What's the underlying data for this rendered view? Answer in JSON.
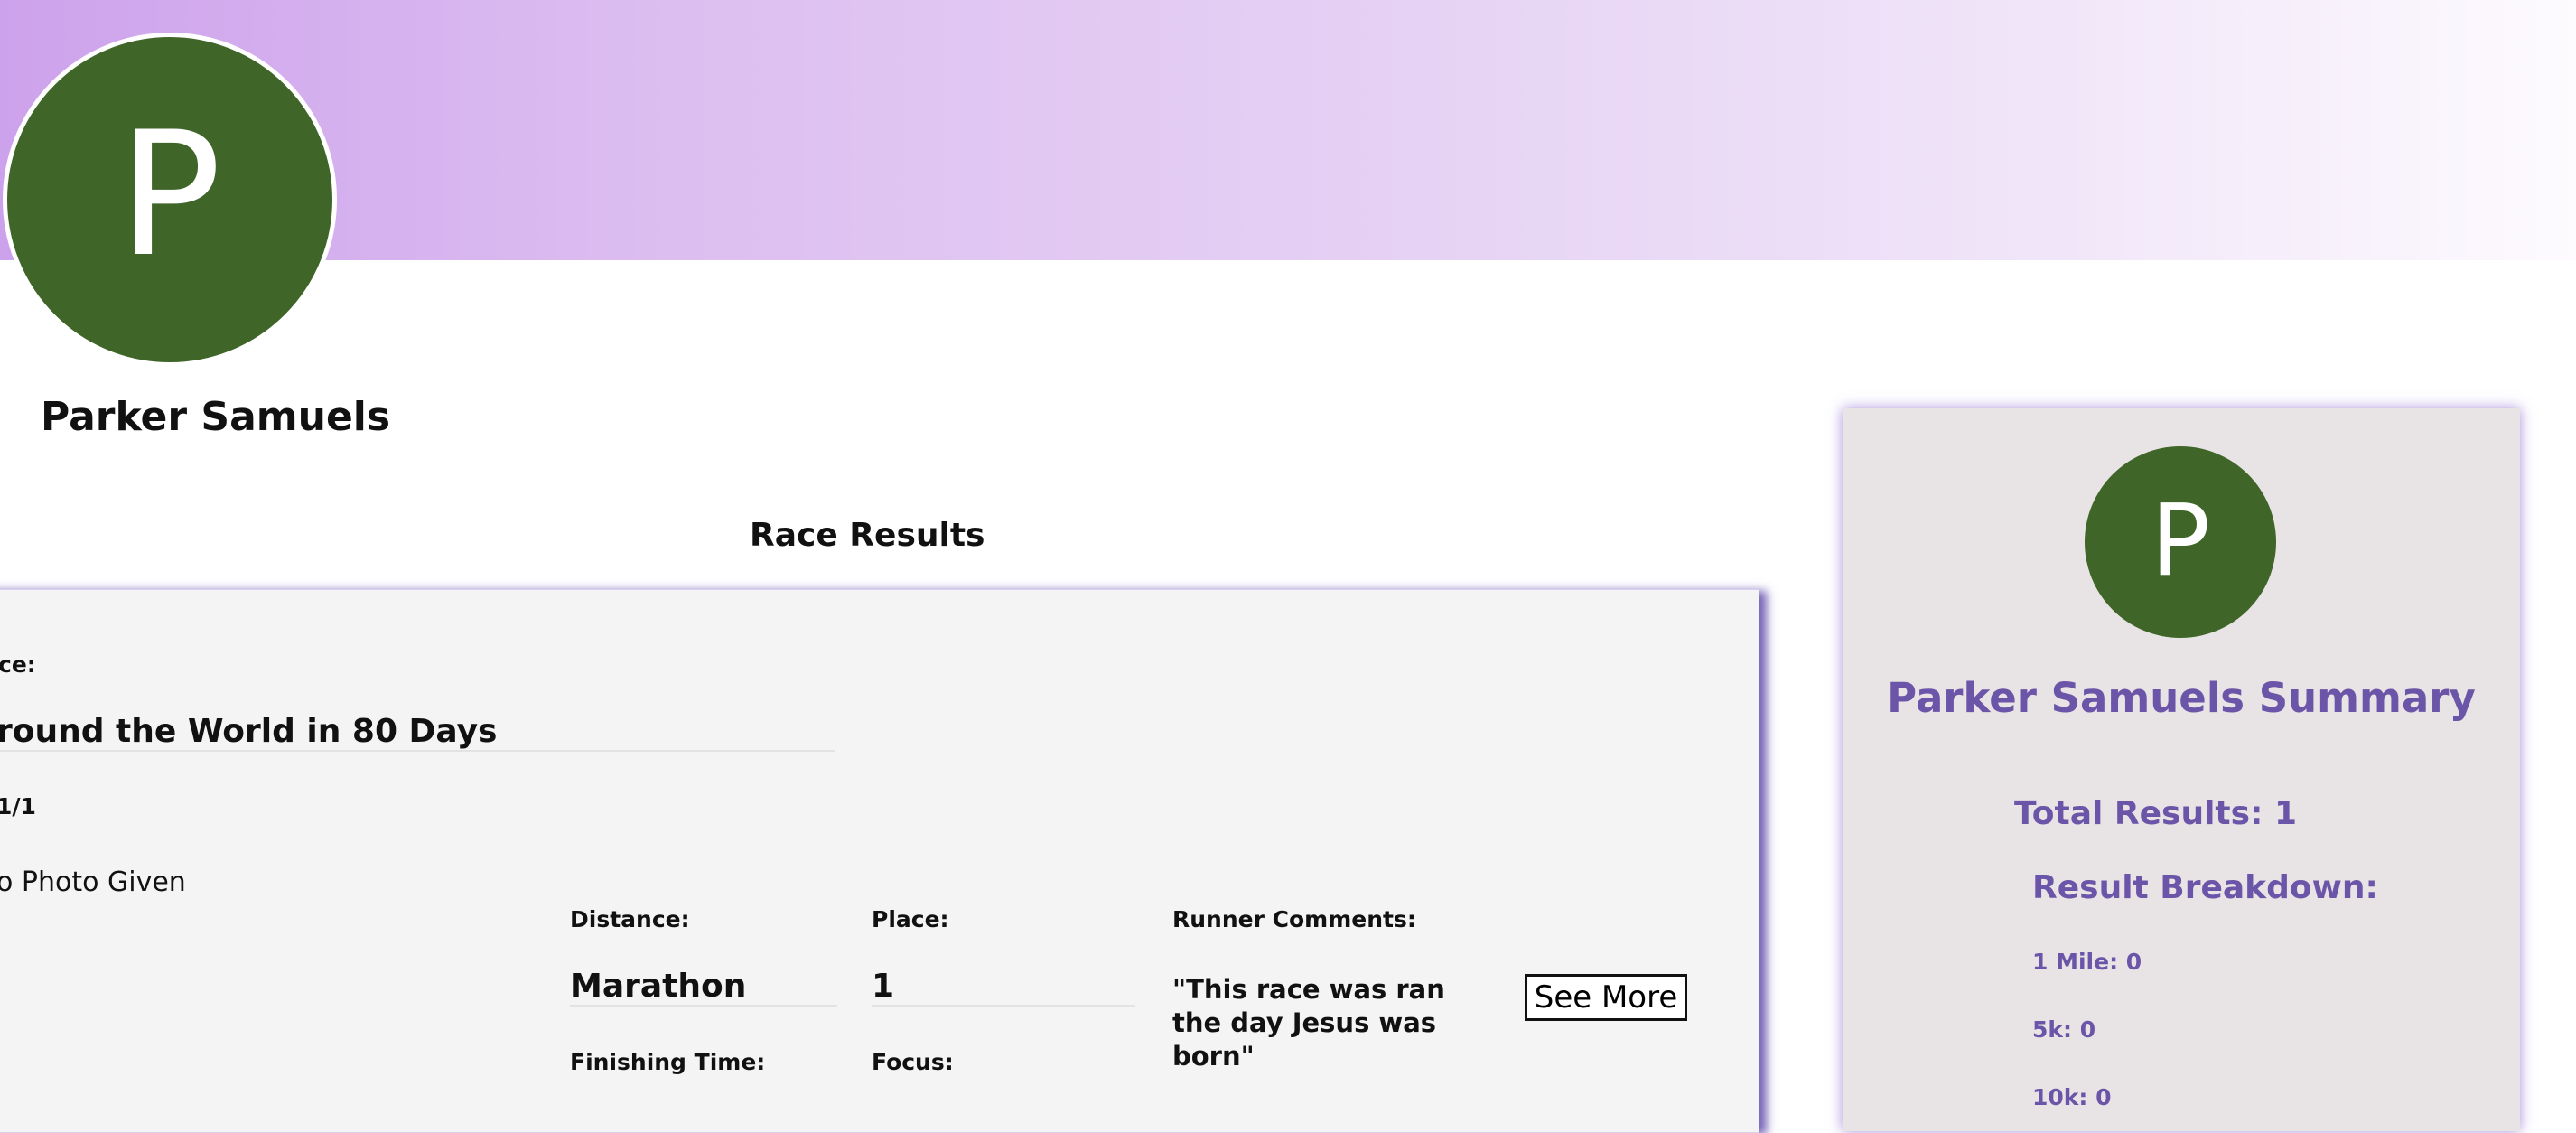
{
  "profile": {
    "initial": "P",
    "name": "Parker Samuels"
  },
  "results_section": {
    "title": "Race Results"
  },
  "result": {
    "race_label": "ce:",
    "race_name": "round the World in 80 Days",
    "date": "1/1",
    "photo": "o Photo Given",
    "distance_label": "Distance:",
    "distance": "Marathon",
    "place_label": "Place:",
    "place": "1",
    "comments_label": "Runner Comments:",
    "comments": "\"This race was ran the day Jesus was born\"",
    "see_more_label": "See More",
    "finishing_time_label": "Finishing Time:",
    "focus_label": "Focus:"
  },
  "summary": {
    "initial": "P",
    "title": "Parker Samuels Summary",
    "total_results": "Total Results: 1",
    "breakdown_label": "Result Breakdown:",
    "breakdown": [
      "1 Mile: 0",
      "5k: 0",
      "10k: 0"
    ]
  },
  "colors": {
    "accent": "#6a55a8",
    "avatar": "#3f6529",
    "banner_start": "#cda2ec"
  }
}
